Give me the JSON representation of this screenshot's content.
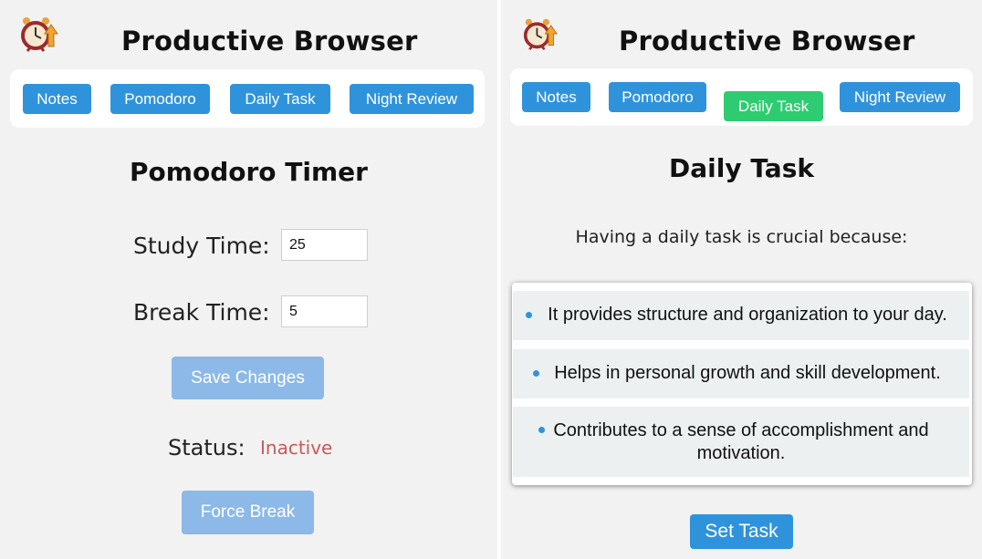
{
  "app": {
    "title": "Productive Browser",
    "logo_icon": "alarm-clock-arrows-icon"
  },
  "nav": {
    "items": [
      {
        "label": "Notes"
      },
      {
        "label": "Pomodoro"
      },
      {
        "label": "Daily Task"
      },
      {
        "label": "Night Review"
      }
    ],
    "colors": {
      "default": "#2f93dc",
      "active": "#2ecc71"
    }
  },
  "pomodoro": {
    "title": "Pomodoro Timer",
    "study_label": "Study Time:",
    "study_value": "25",
    "break_label": "Break Time:",
    "break_value": "5",
    "save_label": "Save Changes",
    "status_label": "Status:",
    "status_value": "Inactive",
    "force_break_label": "Force Break"
  },
  "daily_task": {
    "active_tab": "Daily Task",
    "title": "Daily Task",
    "intro": "Having a daily task is crucial because:",
    "reasons": [
      "It provides structure and organization to your day.",
      "Helps in personal growth and skill development.",
      "Contributes to a sense of accomplishment and motivation."
    ],
    "set_task_label": "Set Task"
  }
}
